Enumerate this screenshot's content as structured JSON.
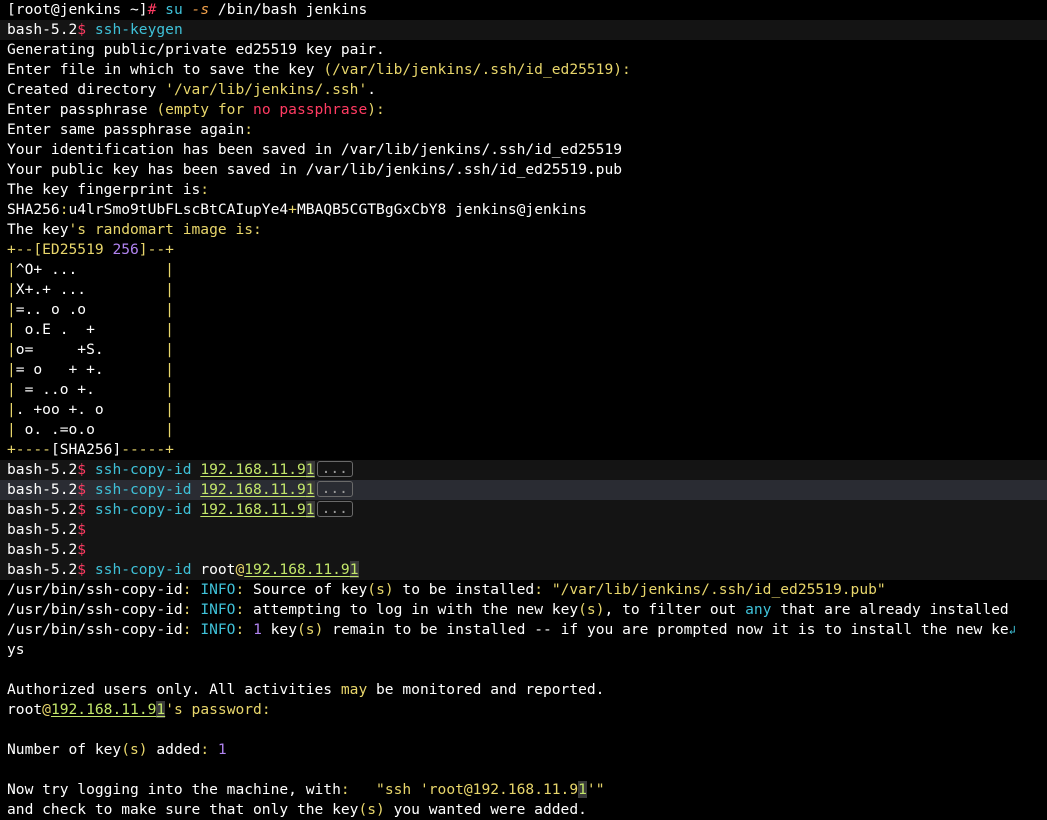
{
  "lines": {
    "l01": {
      "p": "[root@jenkins ~]",
      "hash": "#",
      "cmd": " su ",
      "opt": "-s",
      "rest": " /bin/bash jenkins"
    },
    "l02": {
      "prompt": "bash-5.2",
      "dollar": "$",
      "cmd": " ssh-keygen"
    },
    "l03": {
      "text": "Generating public/private ed25519 key pair."
    },
    "l04": {
      "a": "Enter file in which to save the key ",
      "b": "(/var/lib/jenkins/.ssh/id_ed25519):"
    },
    "l05": {
      "a": "Created directory ",
      "b": "'/var/lib/jenkins/.ssh'",
      "c": "."
    },
    "l06": {
      "a": "Enter passphrase ",
      "b": "(empty for ",
      "c": "no passphrase",
      "d": "):"
    },
    "l07": {
      "a": "Enter same passphrase again",
      "b": ":"
    },
    "l08": {
      "text": "Your identification has been saved in /var/lib/jenkins/.ssh/id_ed25519"
    },
    "l09": {
      "text": "Your public key has been saved in /var/lib/jenkins/.ssh/id_ed25519.pub"
    },
    "l10": {
      "a": "The key fingerprint is",
      "b": ":"
    },
    "l11": {
      "a": "SHA256",
      "b": ":",
      "c": "u4lrSmo9tUbFLscBtCAIupYe4",
      "d": "+",
      "e": "MBAQB5CGTBgGxCbY8 jenkins@jenkins"
    },
    "l12": {
      "a": "The key",
      "b": "'s randomart image is:"
    },
    "l13": {
      "a": "+--[ED25519 ",
      "b": "256",
      "c": "]--+"
    },
    "l14": {
      "a": "|",
      "b": "^O+ ...",
      "c": "          |"
    },
    "l15": {
      "a": "|",
      "b": "X+.+ ...",
      "c": "         |"
    },
    "l16": {
      "a": "|",
      "b": "=.. o .o",
      "c": "         |"
    },
    "l17": {
      "a": "| ",
      "b": "o.E .  +",
      "c": "        |"
    },
    "l18": {
      "a": "|",
      "b": "o=     +S.",
      "c": "       |"
    },
    "l19": {
      "a": "|",
      "b": "= o   + +.",
      "c": "       |"
    },
    "l20": {
      "a": "| ",
      "b": "= ..o +.",
      "c": "        |"
    },
    "l21": {
      "a": "|",
      "b": ". +oo +. o",
      "c": "       |"
    },
    "l22": {
      "a": "| ",
      "b": "o. .=o.o",
      "c": "        |"
    },
    "l23": {
      "a": "+----",
      "b": "[SHA256]",
      "c": "-----+"
    },
    "l24": {
      "prompt": "bash-5.2",
      "dollar": "$",
      "cmd": " ssh-copy-id ",
      "ip": "192.168.11.9",
      "ip2": "1",
      "ell": "..."
    },
    "l25": {
      "prompt": "bash-5.2",
      "dollar": "$",
      "cmd": " ssh-copy-id ",
      "ip": "192.168.11.9",
      "ip2": "1",
      "ell": "..."
    },
    "l26": {
      "prompt": "bash-5.2",
      "dollar": "$",
      "cmd": " ssh-copy-id ",
      "ip": "192.168.11.9",
      "ip2": "1",
      "ell": "..."
    },
    "l27": {
      "prompt": "bash-5.2",
      "dollar": "$"
    },
    "l28": {
      "prompt": "bash-5.2",
      "dollar": "$"
    },
    "l29": {
      "prompt": "bash-5.2",
      "dollar": "$",
      "cmd": " ssh-copy-id",
      "user": " root",
      "at": "@",
      "ip": "192.168.11.9",
      "ip2": "1"
    },
    "l30": {
      "a": "/usr/bin/ssh-copy-id",
      "b": ":",
      "c": " INFO",
      "d": ":",
      "e": " Source of key",
      "f": "(s)",
      "g": " to be installed",
      "h": ":",
      "i": " \"/var/lib/jenkins/.ssh/id_ed25519.pub\""
    },
    "l31": {
      "a": "/usr/bin/ssh-copy-id",
      "b": ":",
      "c": " INFO",
      "d": ":",
      "e": " attempting to log in with the new key",
      "f": "(s)",
      "g": ", to filter out ",
      "h": "any",
      "i": " that are already installed"
    },
    "l32": {
      "a": "/usr/bin/ssh-copy-id",
      "b": ":",
      "c": " INFO",
      "d": ":",
      "e": " ",
      "f": "1",
      "g": " key",
      "h": "(s)",
      "i": " remain to be installed -- if you are prompted now it is to install the new ke",
      "wrap": "↲"
    },
    "l33": {
      "text": "ys"
    },
    "l34": {
      "text": ""
    },
    "l35": {
      "a": "Authorized users only. All activities ",
      "b": "may",
      "c": " be monitored and reported."
    },
    "l36": {
      "a": "root",
      "b": "@",
      "c": "192.168.11.9",
      "c2": "1",
      "d": "'s password:"
    },
    "l37": {
      "text": ""
    },
    "l38": {
      "a": "Number of key",
      "b": "(s)",
      "c": " added",
      "d": ":",
      "e": " 1"
    },
    "l39": {
      "text": ""
    },
    "l40": {
      "a": "Now try logging into the machine, with",
      "b": ":",
      "c": "   \"ssh ",
      "d": "'root@192.168.11.9",
      "d2": "1",
      "e": "'",
      "f": "\""
    },
    "l41": {
      "a": "and check to make sure that only the key",
      "b": "(s)",
      "c": " you wanted were added."
    }
  },
  "colors": {
    "background": "#000000",
    "foreground": "#ffffff",
    "prompt_symbol": "#ff3b62",
    "command": "#3fc1d8",
    "path_string": "#c3e66a",
    "keyword": "#e8d66b",
    "number": "#b083f0"
  }
}
